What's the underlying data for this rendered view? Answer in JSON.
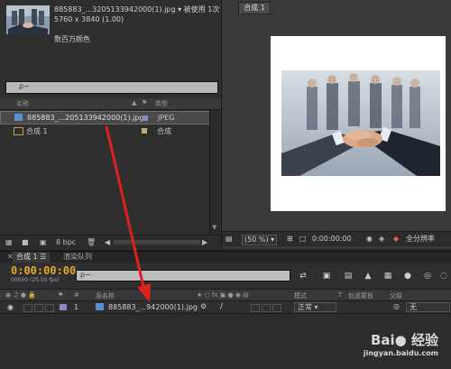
{
  "project": {
    "file_name": "885883_...3205133942000(1).jpg ▾",
    "used_count": "被使用 1次",
    "dimensions": "5760 x 3840 (1.00)",
    "color_depth": "数百万颜色",
    "search_placeholder": "ρ−",
    "columns": {
      "name": "名称",
      "type": "类型"
    },
    "items": [
      {
        "name": "885883_...205133942000(1).jpg",
        "type": "JPEG",
        "swatch": "#8a8ac8"
      },
      {
        "name": "合成 1",
        "type": "合成",
        "swatch": "#c8a878"
      }
    ],
    "footer": {
      "bpc": "8 bpc"
    }
  },
  "viewer": {
    "tab": "合成 1",
    "zoom": "(50 %)",
    "timecode": "0:00:00:00",
    "res_label": "全分辨率"
  },
  "timeline": {
    "tab_comp": "合成 1",
    "tab_render": "渲染队列",
    "timecode": "0:00:00:00",
    "fps": "00000 (25.00 fps)",
    "search_placeholder": "ρ−",
    "columns": {
      "source_name": "源名称",
      "mode": "模式",
      "t": "T",
      "track_matte": "轨道蒙板",
      "parent": "父级"
    },
    "layer": {
      "number": "1",
      "name": "885883_...942000(1).jpg",
      "mode": "正常",
      "parent": "无"
    }
  },
  "watermark": {
    "brand": "Bai● 经验",
    "url": "jingyan.baidu.com"
  },
  "colors": {
    "timecode": "#e8a92a",
    "arrow": "#e02020"
  }
}
